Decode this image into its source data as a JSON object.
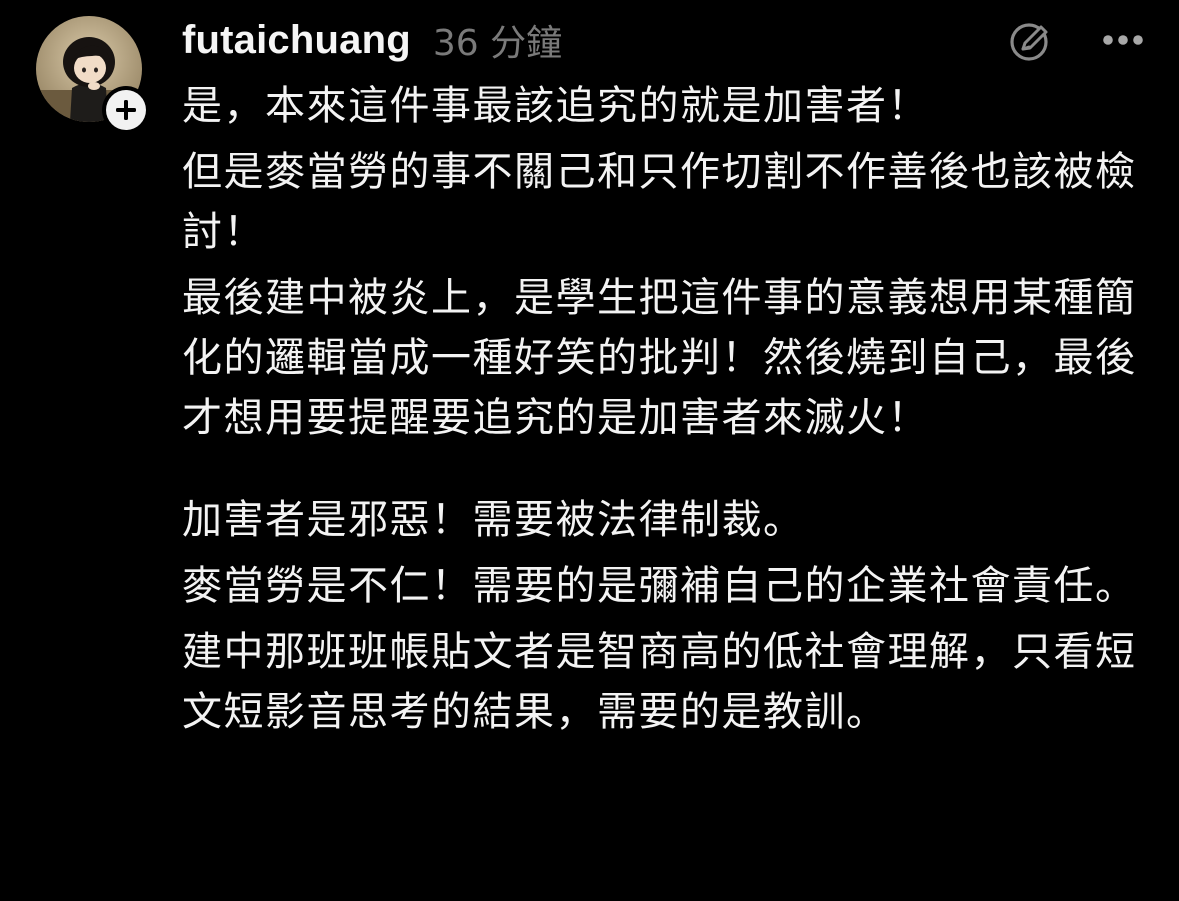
{
  "post": {
    "username": "futaichuang",
    "timestamp": "36 分鐘",
    "paragraphs": [
      "是，本來這件事最該追究的就是加害者！",
      "但是麥當勞的事不關己和只作切割不作善後也該被檢討！",
      "最後建中被炎上，是學生把這件事的意義想用某種簡化的邏輯當成一種好笑的批判！然後燒到自己，最後才想用要提醒要追究的是加害者來滅火！",
      "加害者是邪惡！需要被法律制裁。",
      "麥當勞是不仁！需要的是彌補自己的企業社會責任。",
      "建中那班班帳貼文者是智商高的低社會理解，只看短文短影音思考的結果，需要的是教訓。"
    ]
  },
  "icons": {
    "avatar": "avatar-figurine-image",
    "follow": "plus-icon",
    "translate": "edit-circle-icon",
    "more": "more-dots-icon"
  },
  "colors": {
    "background": "#000000",
    "text": "#f3f3f3",
    "muted": "#7a7a7a"
  }
}
